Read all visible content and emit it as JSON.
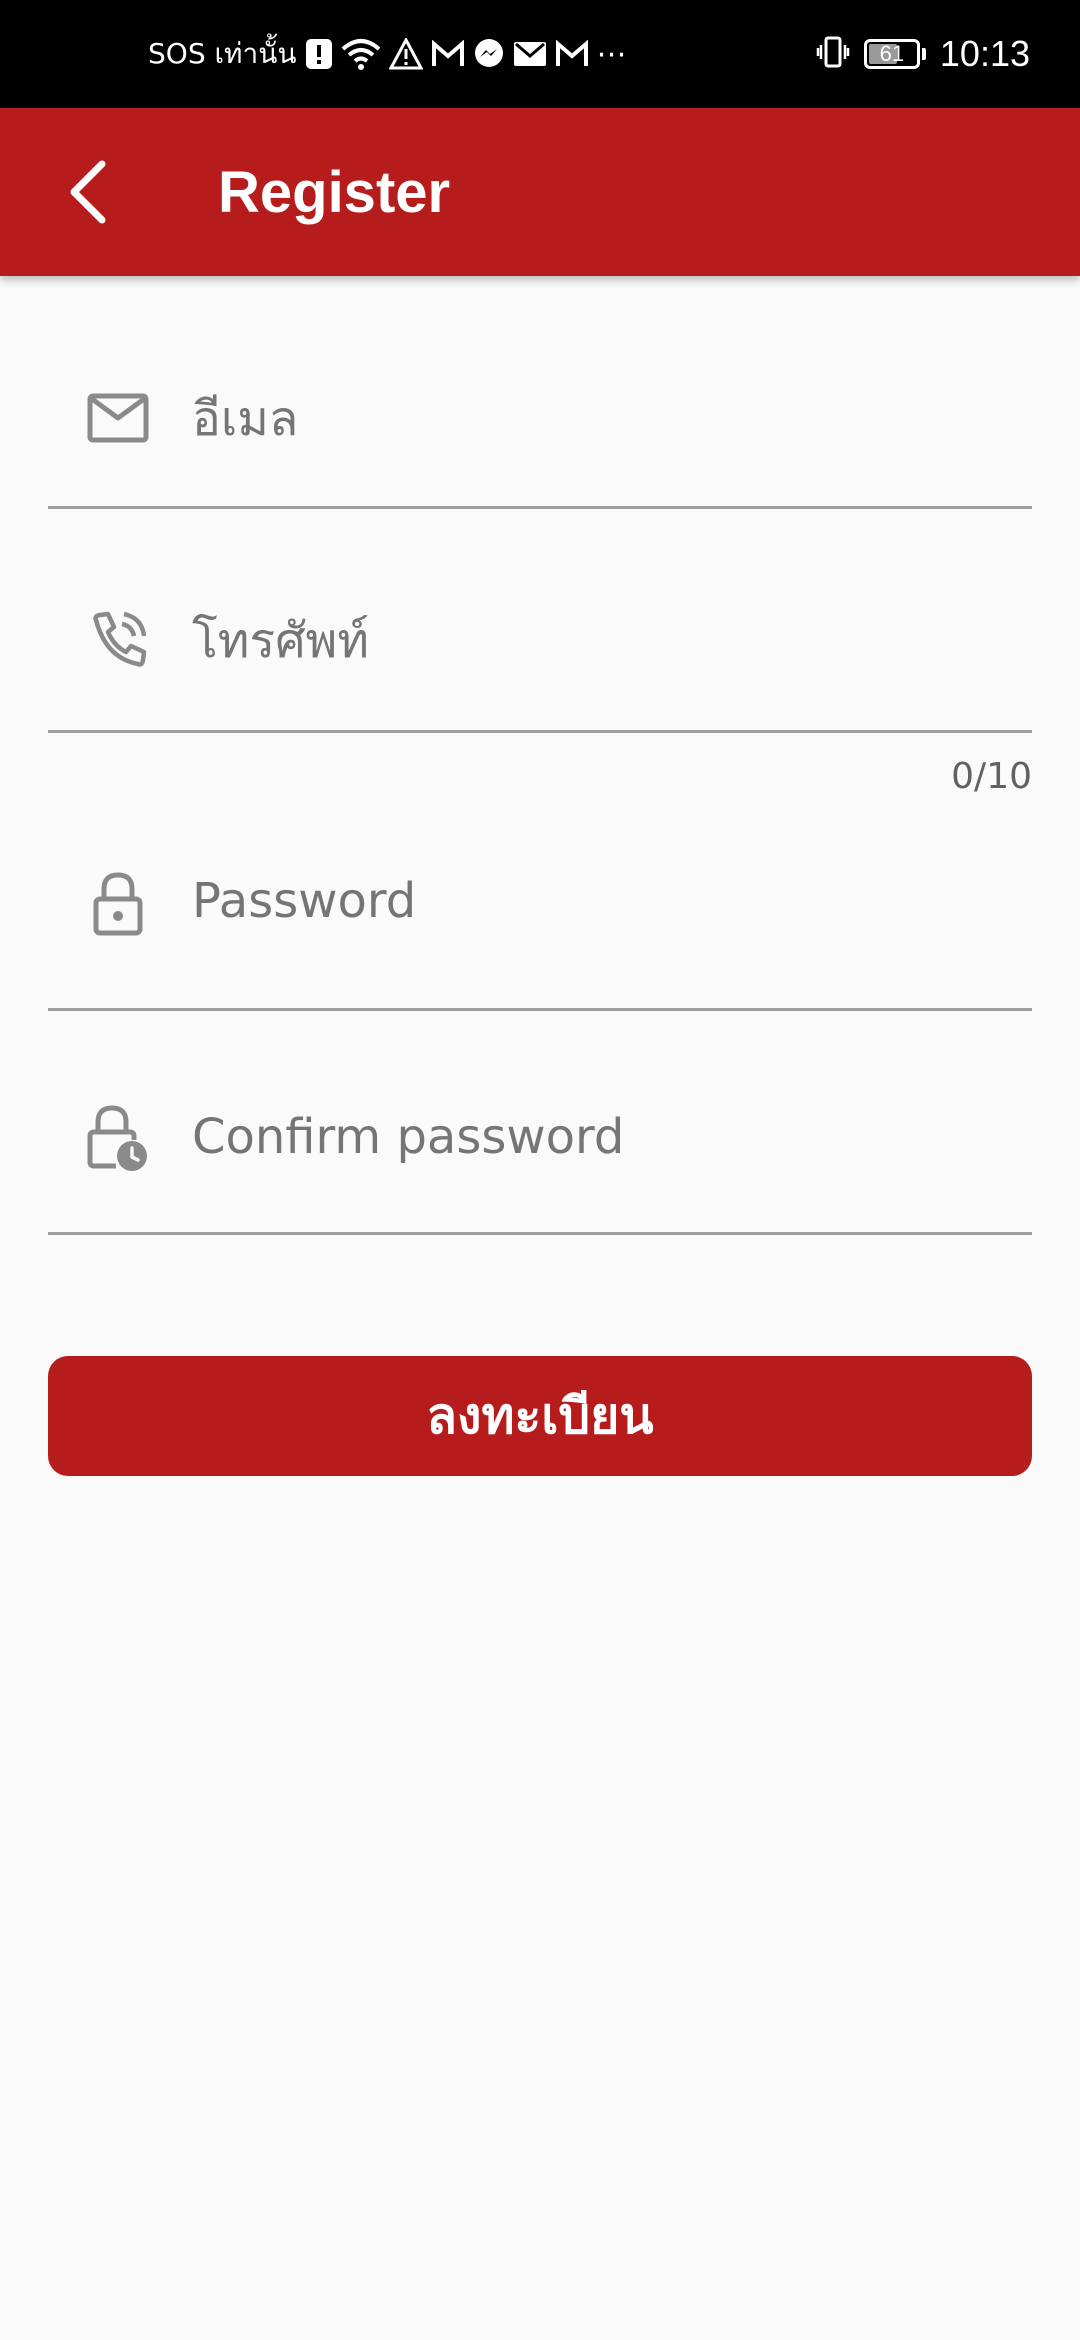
{
  "status_bar": {
    "carrier_text": "SOS เท่านั้น",
    "time": "10:13",
    "battery_level": "61",
    "battery_fraction": 0.61,
    "more_indicator": "⋯"
  },
  "app_bar": {
    "title": "Register",
    "background_color": "#b71c1c"
  },
  "form": {
    "email": {
      "placeholder": "อีเมล",
      "icon": "mail-icon"
    },
    "phone": {
      "placeholder": "โทรศัพท์",
      "icon": "phone-icon",
      "counter": "0/10"
    },
    "password": {
      "placeholder": "Password",
      "icon": "lock-icon"
    },
    "confirm_password": {
      "placeholder": "Confirm password",
      "icon": "lock-clock-icon"
    },
    "submit_label": "ลงทะเบียน"
  }
}
